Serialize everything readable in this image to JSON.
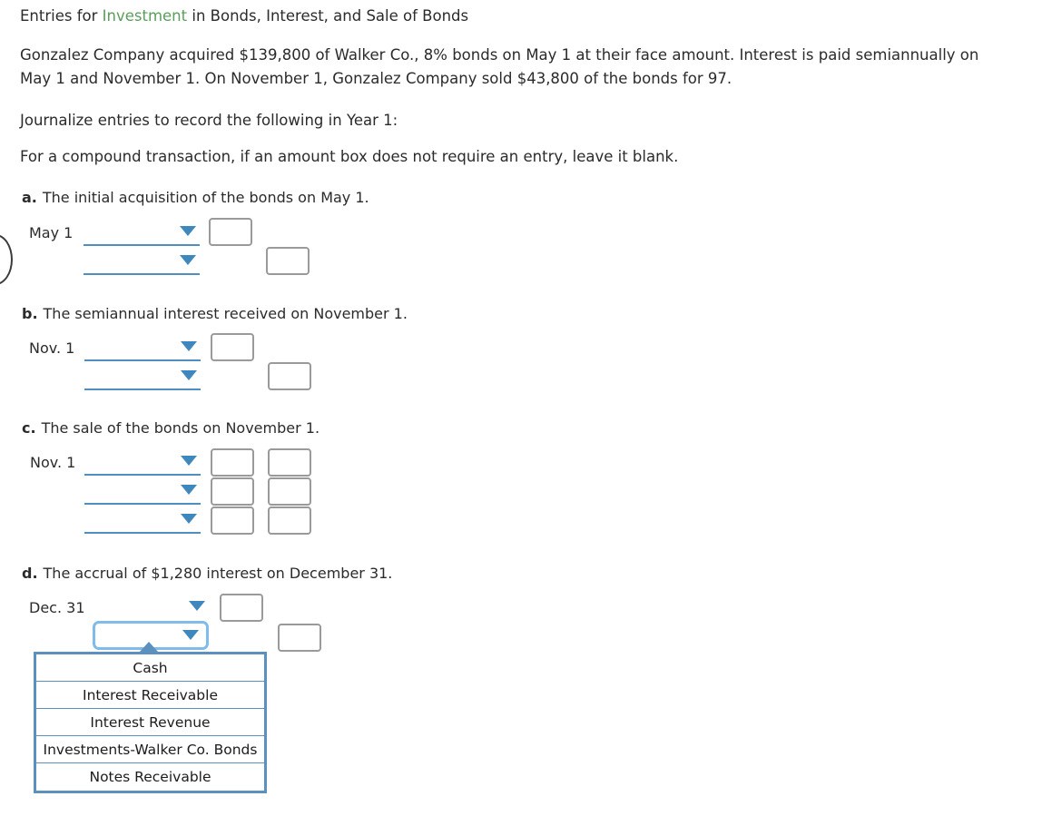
{
  "header": {
    "title_before": "Entries for ",
    "title_highlight": "Investment",
    "title_after": " in Bonds, Interest, and Sale of Bonds",
    "highlight_color": "#5a9e5c",
    "problem": "Gonzalez Company acquired $139,800 of Walker Co., 8% bonds on May 1 at their face amount. Interest is paid semiannually on May 1 and November 1. On November 1, Gonzalez Company sold $43,800 of the bonds for 97.",
    "journalize": "Journalize entries to record the following in Year 1:",
    "compound_note": "For a compound transaction, if an amount box does not require an entry, leave it blank."
  },
  "requirements": [
    {
      "letter": "a.",
      "text": "The initial acquisition of the bonds on May 1.",
      "date": "May 1"
    },
    {
      "letter": "b.",
      "text": "The semiannual interest received on November 1.",
      "date": "Nov. 1"
    },
    {
      "letter": "c.",
      "text": "The sale of the bonds on November 1.",
      "date": "Nov. 1"
    },
    {
      "letter": "d.",
      "text": "The accrual of $1,280 interest on December 31.",
      "date": "Dec. 31"
    }
  ],
  "entry_a": {
    "date": "May 1",
    "rows": [
      {
        "account": "",
        "debit": "",
        "credit": ""
      },
      {
        "account": "",
        "debit": "",
        "credit": ""
      }
    ]
  },
  "entry_b": {
    "date": "Nov. 1",
    "rows": [
      {
        "account": "",
        "debit": "",
        "credit": ""
      },
      {
        "account": "",
        "debit": "",
        "credit": ""
      }
    ]
  },
  "entry_c": {
    "date": "Nov. 1",
    "rows": [
      {
        "account": "",
        "debit": "",
        "credit": ""
      },
      {
        "account": "",
        "debit": "",
        "credit": ""
      },
      {
        "account": "",
        "debit": "",
        "credit": ""
      }
    ]
  },
  "entry_d": {
    "date": "Dec. 31",
    "rows": [
      {
        "account": "",
        "debit": "",
        "credit": ""
      },
      {
        "account": "",
        "debit": "",
        "credit": ""
      }
    ]
  },
  "dropdown": {
    "open": true,
    "options": [
      "Cash",
      "Interest Receivable",
      "Interest Revenue",
      "Investments-Walker Co. Bonds",
      "Notes Receivable"
    ],
    "border_color": "#5b90bf",
    "focus_color": "#7fbcec"
  },
  "icons": {
    "caret": "dropdown-caret-icon"
  }
}
